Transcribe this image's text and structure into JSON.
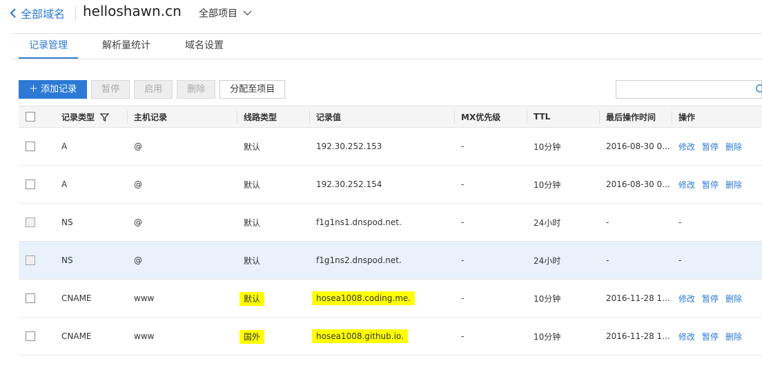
{
  "header": {
    "back_label": "全部域名",
    "domain": "helloshawn.cn",
    "project_selector": "全部项目"
  },
  "tabs": [
    {
      "label": "记录管理",
      "active": true
    },
    {
      "label": "解析量统计",
      "active": false
    },
    {
      "label": "域名设置",
      "active": false
    }
  ],
  "toolbar": {
    "add": "＋ 添加记录",
    "pause": "暂停",
    "enable": "启用",
    "delete": "删除",
    "assign": "分配至项目",
    "search_placeholder": ""
  },
  "table": {
    "columns": [
      "记录类型",
      "主机记录",
      "线路类型",
      "记录值",
      "MX优先级",
      "TTL",
      "最后操作时间",
      "操作"
    ],
    "rows": [
      {
        "type": "A",
        "host": "@",
        "line": "默认",
        "value": "192.30.252.153",
        "mx": "-",
        "ttl": "10分钟",
        "time": "2016-08-30 0...",
        "actions": [
          "修改",
          "暂停",
          "删除"
        ]
      },
      {
        "type": "A",
        "host": "@",
        "line": "默认",
        "value": "192.30.252.154",
        "mx": "-",
        "ttl": "10分钟",
        "time": "2016-08-30 0...",
        "actions": [
          "修改",
          "暂停",
          "删除"
        ]
      },
      {
        "type": "NS",
        "host": "@",
        "line": "默认",
        "value": "f1g1ns1.dnspod.net.",
        "mx": "-",
        "ttl": "24小时",
        "time": "-",
        "op_text": "-"
      },
      {
        "type": "NS",
        "host": "@",
        "line": "默认",
        "value": "f1g1ns2.dnspod.net.",
        "mx": "-",
        "ttl": "24小时",
        "time": "-",
        "op_text": "-"
      },
      {
        "type": "CNAME",
        "host": "www",
        "line": "默认",
        "value": "hosea1008.coding.me.",
        "mx": "-",
        "ttl": "10分钟",
        "time": "2016-11-28 1...",
        "actions": [
          "修改",
          "暂停",
          "删除"
        ]
      },
      {
        "type": "CNAME",
        "host": "www",
        "line": "国外",
        "value": "hosea1008.github.io.",
        "mx": "-",
        "ttl": "10分钟",
        "time": "2016-11-28 1...",
        "actions": [
          "修改",
          "暂停",
          "删除"
        ]
      }
    ]
  },
  "colors": {
    "accent": "#2d7ad6",
    "highlight": "#ffff00",
    "row_hover": "#e9f1fb"
  }
}
